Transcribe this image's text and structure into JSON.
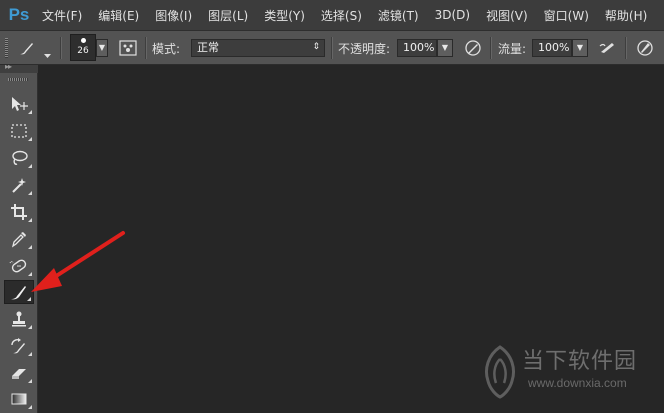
{
  "app": {
    "logo": "Ps"
  },
  "menu": {
    "items": [
      "文件(F)",
      "编辑(E)",
      "图像(I)",
      "图层(L)",
      "类型(Y)",
      "选择(S)",
      "滤镜(T)",
      "3D(D)",
      "视图(V)",
      "窗口(W)",
      "帮助(H)"
    ]
  },
  "options": {
    "brush_size": "26",
    "mode_label": "模式:",
    "mode_value": "正常",
    "opacity_label": "不透明度:",
    "opacity_value": "100%",
    "flow_label": "流量:",
    "flow_value": "100%"
  },
  "toolbox": {
    "collapse_glyph": "▸▸",
    "tools": [
      "move-tool",
      "marquee-tool",
      "lasso-tool",
      "magic-wand-tool",
      "crop-tool",
      "eyedropper-tool",
      "spot-healing-tool",
      "brush-tool",
      "clone-stamp-tool",
      "history-brush-tool",
      "eraser-tool",
      "gradient-tool"
    ],
    "active_tool": "brush-tool"
  },
  "annotation": {
    "arrow_color": "#e0201c"
  },
  "watermark": {
    "title": "当下软件园",
    "url": "www.downxia.com"
  },
  "colors": {
    "menubar_bg": "#3c3c3c",
    "panel_bg": "#535353",
    "canvas_bg": "#262626",
    "ps_logo": "#3f9bd4"
  }
}
